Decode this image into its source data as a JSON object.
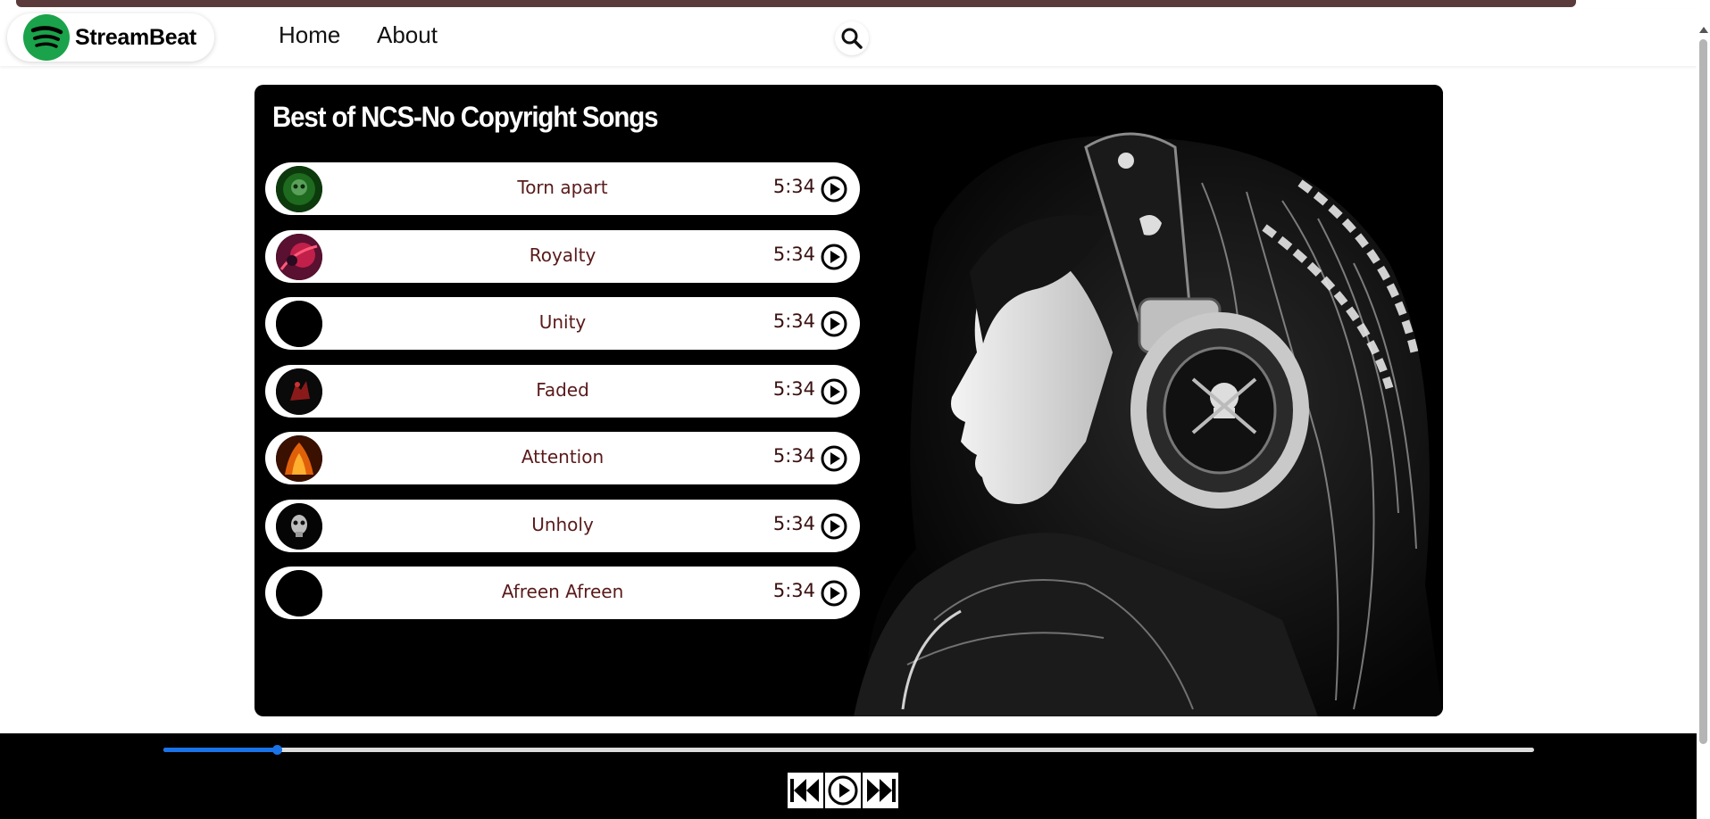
{
  "brand": {
    "name": "StreamBeat",
    "logo_icon": "spotify-like-logo-icon",
    "color": "#1aa34a"
  },
  "nav": {
    "home_label": "Home",
    "about_label": "About",
    "search_icon": "search-icon"
  },
  "playlist": {
    "title": "Best of NCS-No Copyright Songs",
    "songs": [
      {
        "name": "Torn apart",
        "duration": "5:34",
        "cover": "green-skull-cover"
      },
      {
        "name": "Royalty",
        "duration": "5:34",
        "cover": "red-burst-cover"
      },
      {
        "name": "Unity",
        "duration": "5:34",
        "cover": "black-cover"
      },
      {
        "name": "Faded",
        "duration": "5:34",
        "cover": "dark-red-figure-cover"
      },
      {
        "name": "Attention",
        "duration": "5:34",
        "cover": "fire-cover"
      },
      {
        "name": "Unholy",
        "duration": "5:34",
        "cover": "skull-cover"
      },
      {
        "name": "Afreen Afreen",
        "duration": "5:34",
        "cover": "black-cover"
      }
    ]
  },
  "player": {
    "progress_fraction": 0.083,
    "progress_color": "#1a73e8",
    "controls": [
      "previous-track-icon",
      "play-icon",
      "next-track-icon"
    ]
  }
}
